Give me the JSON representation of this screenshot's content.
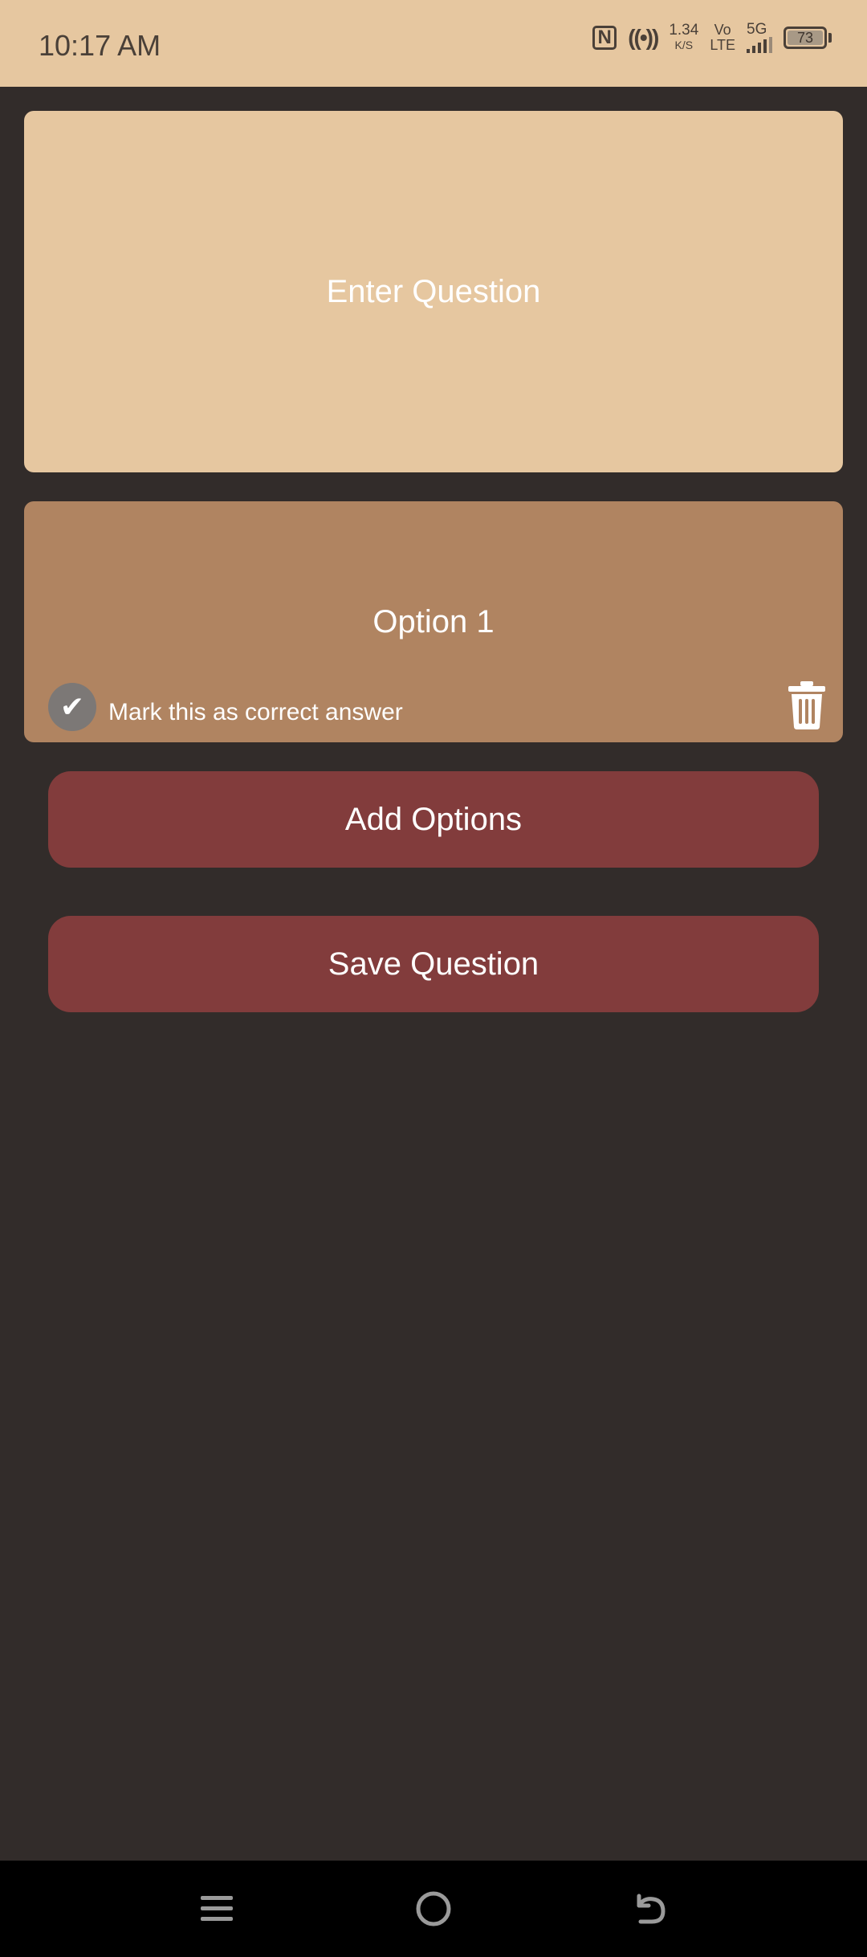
{
  "status_bar": {
    "time": "10:17 AM",
    "nfc_label": "N",
    "hotspot_label": "((•))",
    "net_speed_value": "1.34",
    "net_speed_unit": "K/S",
    "volte_top": "Vo",
    "volte_bottom": "LTE",
    "network_type": "5G",
    "battery_percent": "73"
  },
  "question": {
    "placeholder": "Enter Question"
  },
  "option": {
    "label": "Option 1",
    "mark_correct_label": "Mark this as correct answer",
    "check_glyph": "✔"
  },
  "actions": {
    "add_options_label": "Add Options",
    "save_question_label": "Save Question"
  },
  "colors": {
    "status_bg": "#e6c7a0",
    "page_bg": "#322c2a",
    "question_bg": "#e6c7a0",
    "option_bg": "#b08461",
    "button_bg": "#823c3c"
  },
  "icons": {
    "delete": "trash-icon",
    "nav_menu": "menu-icon",
    "nav_home": "home-icon",
    "nav_back": "back-icon"
  }
}
